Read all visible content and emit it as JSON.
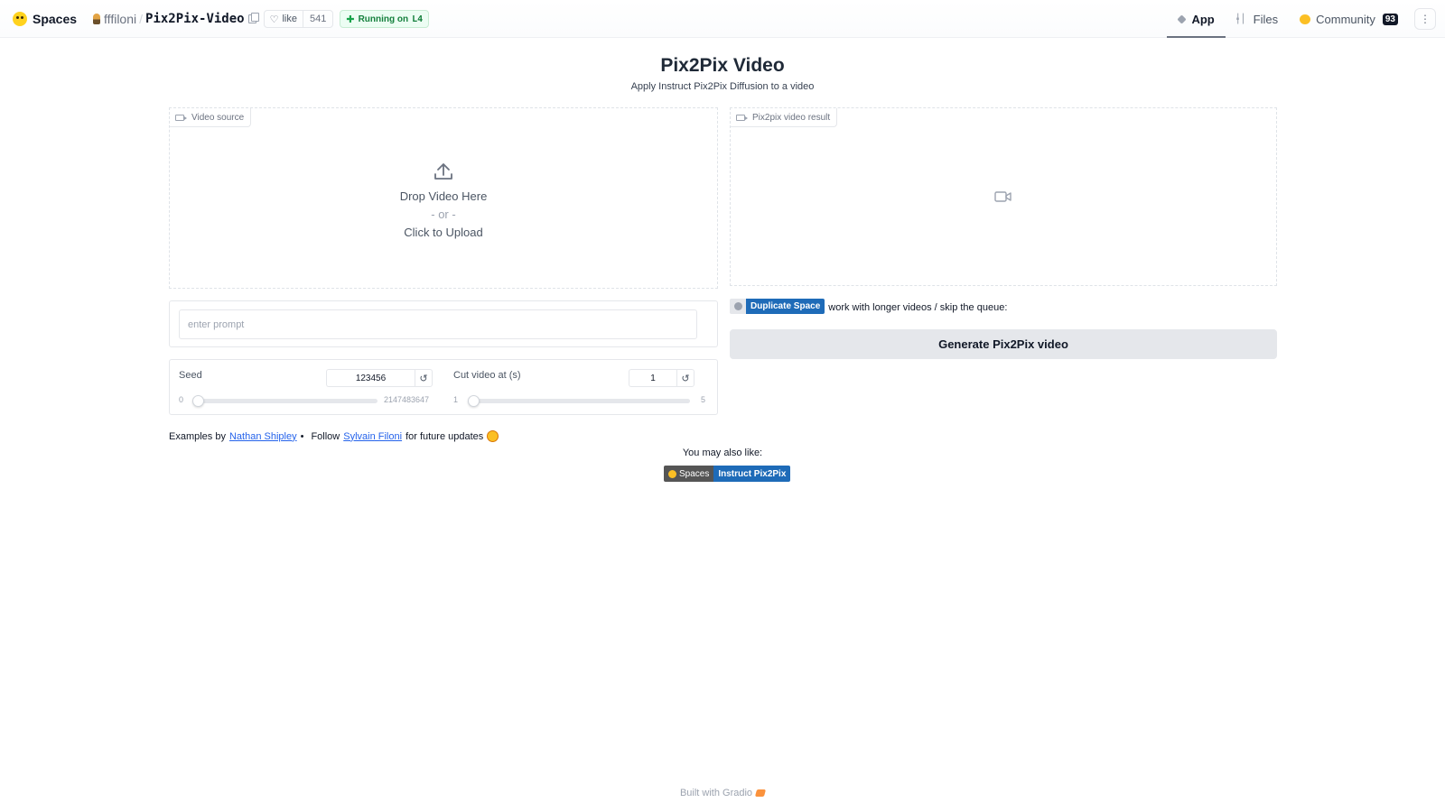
{
  "header": {
    "brand": "Spaces",
    "owner": "fffiloni",
    "repo": "Pix2Pix-Video",
    "like_label": "like",
    "like_count": "541",
    "running_label": "Running on",
    "hardware": "L4",
    "tabs": [
      {
        "label": "App",
        "icon": "cube-icon",
        "active": true
      },
      {
        "label": "Files",
        "icon": "files-icon",
        "active": false
      },
      {
        "label": "Community",
        "icon": "community-icon",
        "active": false,
        "count": "93"
      }
    ],
    "more_icon": "more-vertical-icon"
  },
  "app": {
    "title": "Pix2Pix Video",
    "subtitle": "Apply Instruct Pix2Pix Diffusion to a video",
    "video_source": {
      "label": "Video source",
      "drop_text": "Drop Video Here",
      "or_text": "- or -",
      "click_text": "Click to Upload"
    },
    "video_result": {
      "label": "Pix2pix video result"
    },
    "prompt": {
      "placeholder": "enter prompt",
      "value": ""
    },
    "seed": {
      "label": "Seed",
      "value": "123456",
      "min": "0",
      "max": "2147483647",
      "level": 0
    },
    "cut_video": {
      "label": "Cut video at (s)",
      "value": "1",
      "min": "1",
      "max": "5",
      "level": 0
    },
    "duplicate": {
      "badge": "Duplicate Space",
      "text": "work with longer videos / skip the queue:"
    },
    "generate_button": "Generate Pix2Pix video",
    "credits": {
      "examples_by": "Examples by",
      "author1": "Nathan Shipley",
      "sep": "•",
      "follow": "Follow",
      "author2": "Sylvain Filoni",
      "updates": "for future updates"
    },
    "also_like": "You may also like:",
    "badge": {
      "left": "Spaces",
      "right": "Instruct Pix2Pix"
    }
  },
  "footer": {
    "text": "Built with Gradio"
  },
  "colors": {
    "accent_blue": "#1e6bb8",
    "running_green": "#15803d",
    "link": "#2563eb"
  }
}
